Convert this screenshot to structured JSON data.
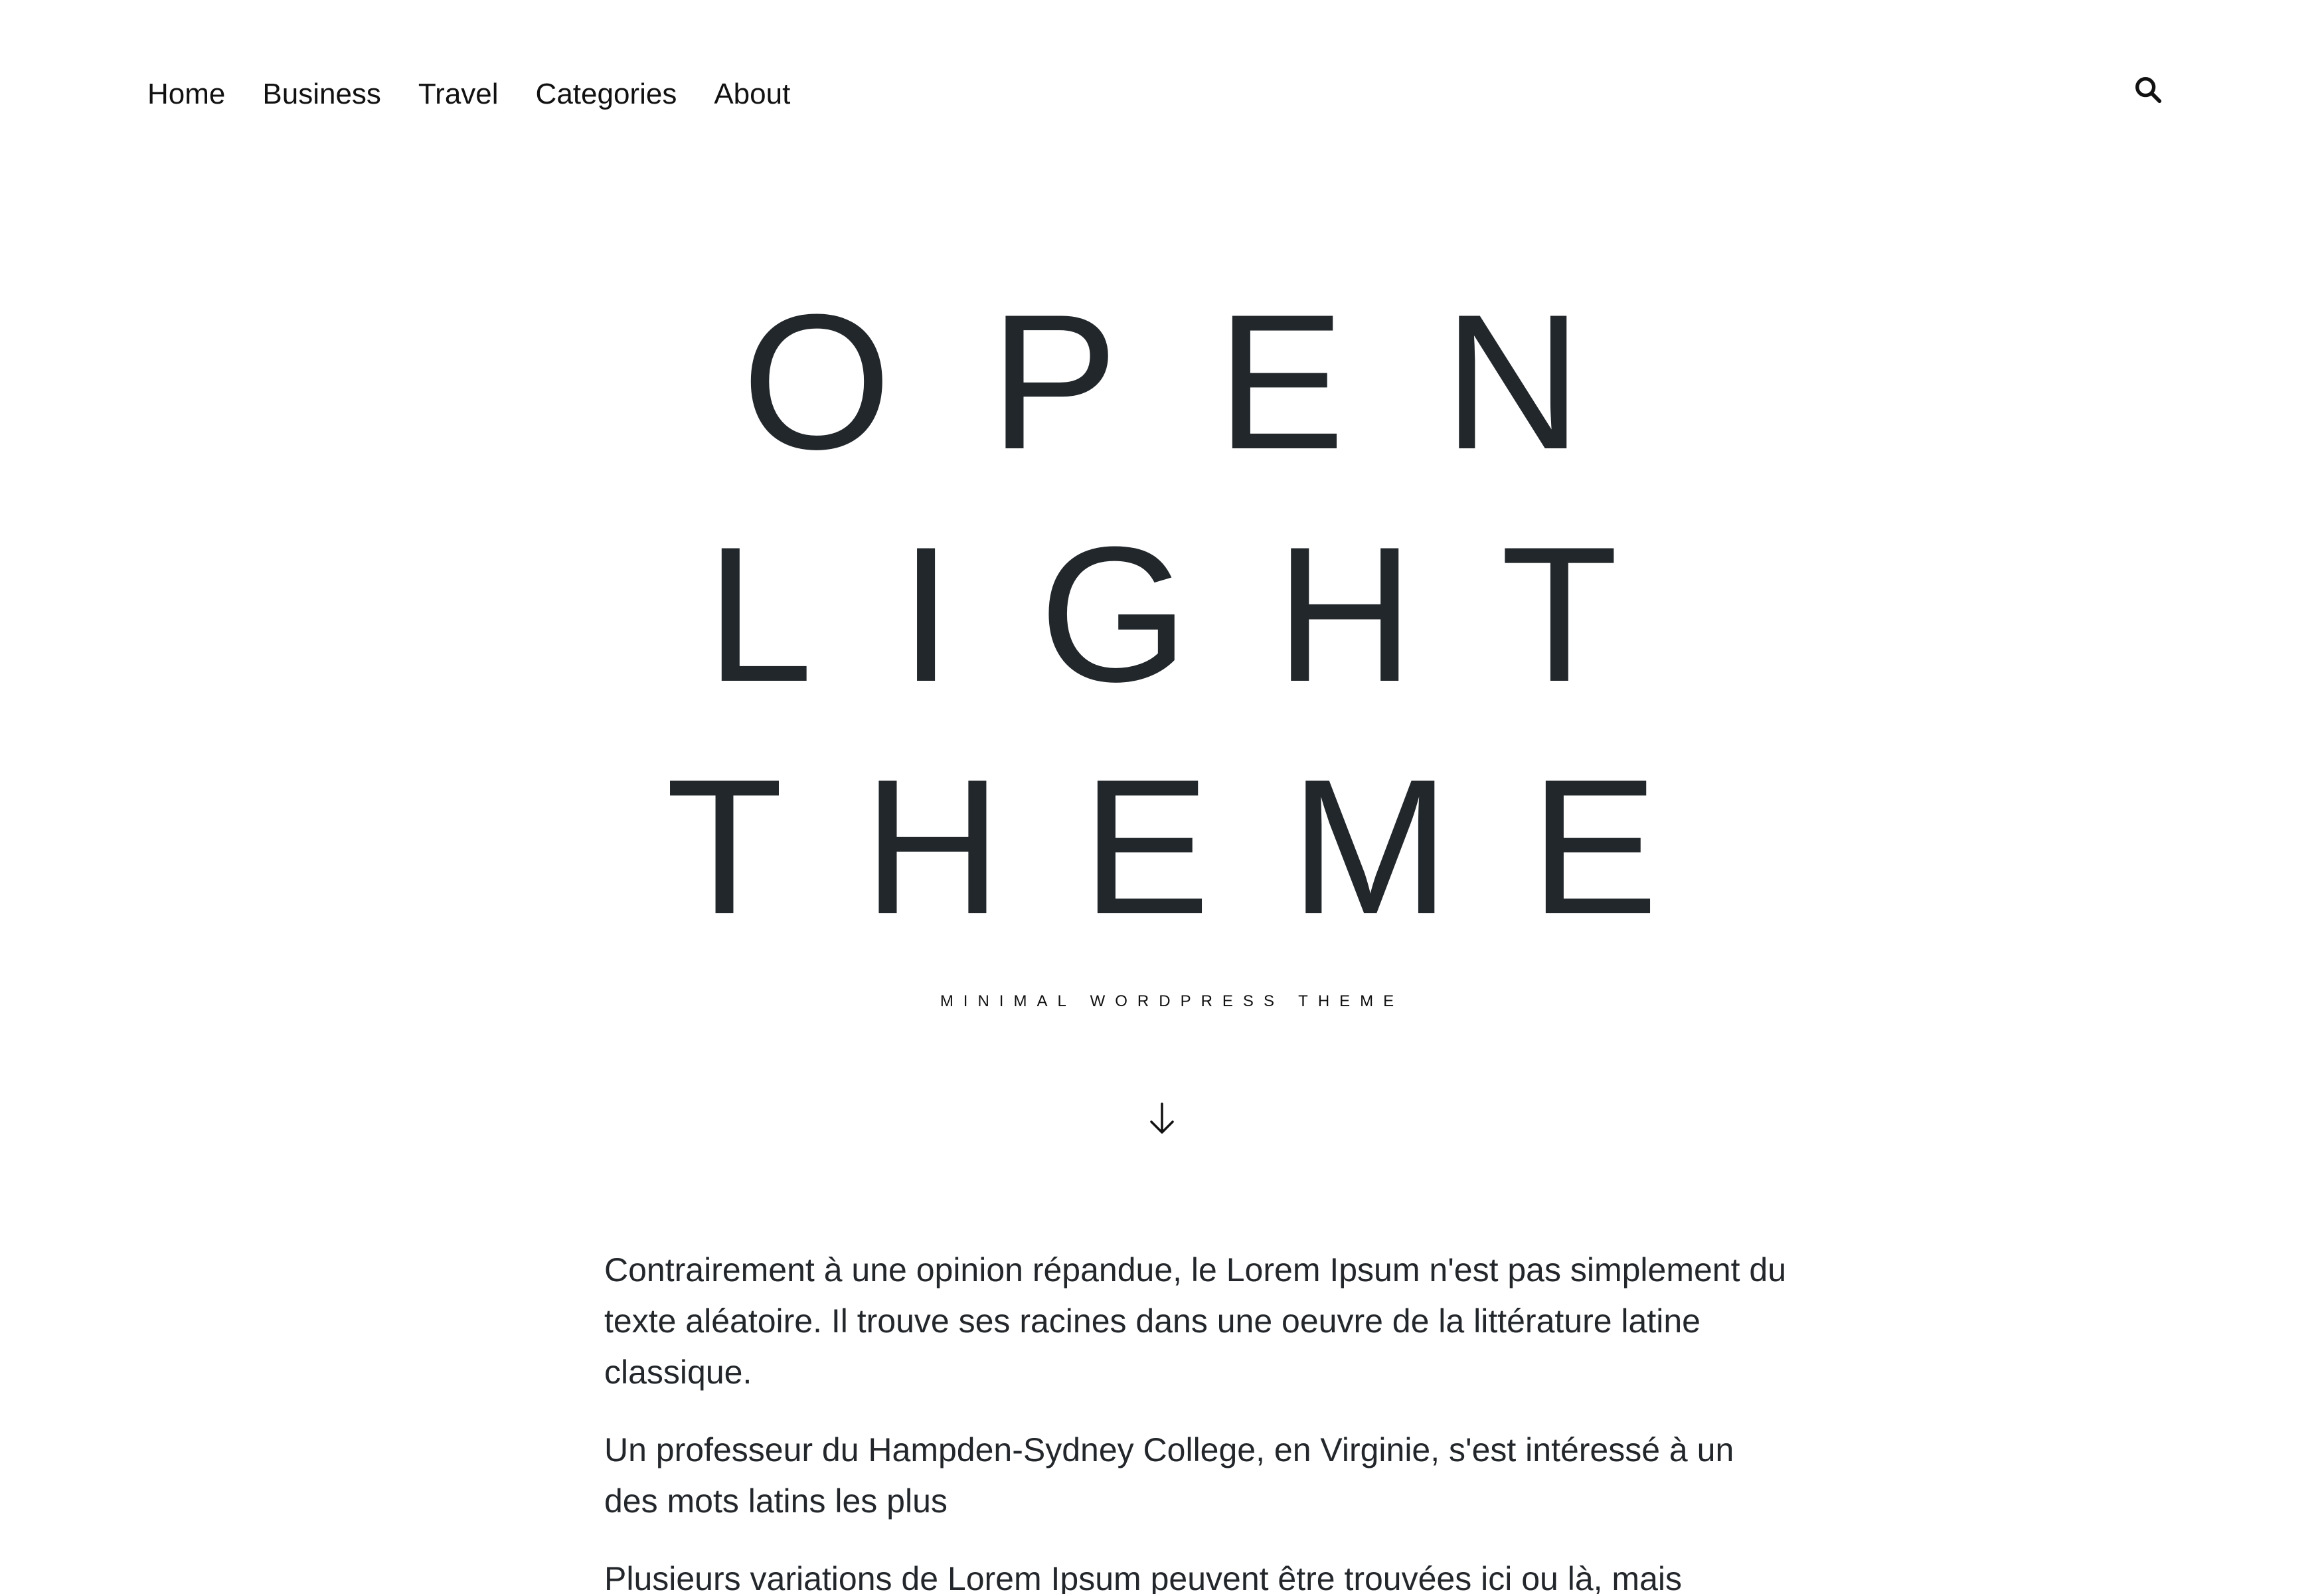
{
  "nav": {
    "items": [
      {
        "label": "Home"
      },
      {
        "label": "Business"
      },
      {
        "label": "Travel"
      },
      {
        "label": "Categories"
      },
      {
        "label": "About"
      }
    ],
    "search_icon": "search-icon"
  },
  "hero": {
    "title_lines": [
      "OPEN",
      "LIGHT",
      "THEME"
    ],
    "tagline": "MINIMAL WORDPRESS THEME",
    "scroll_icon": "arrow-down-icon"
  },
  "content": {
    "paragraphs": [
      "Contrairement à une opinion répandue, le Lorem Ipsum n'est pas simplement du texte aléatoire. Il trouve ses racines dans une oeuvre de la littérature latine classique.",
      "Un professeur du Hampden-Sydney College, en Virginie, s'est intéressé à un des mots latins les plus",
      "Plusieurs variations de Lorem Ipsum peuvent être trouvées ici ou là, mais"
    ]
  },
  "colors": {
    "background": "#ffffff",
    "text": "#23272b",
    "nav_text": "#111111"
  }
}
